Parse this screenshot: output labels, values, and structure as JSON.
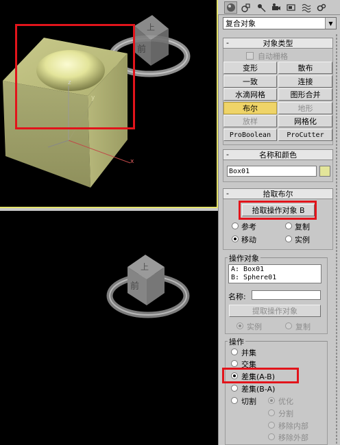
{
  "dropdown": {
    "value": "复合对象"
  },
  "object_type": {
    "header": "对象类型",
    "auto_grid": "自动栅格",
    "buttons": [
      "变形",
      "散布",
      "一致",
      "连接",
      "水滴网格",
      "图形合并",
      "布尔",
      "地形",
      "放样",
      "网格化",
      "ProBoolean",
      "ProCutter"
    ]
  },
  "name_color": {
    "header": "名称和颜色",
    "name": "Box01",
    "color": "#e3e59a"
  },
  "pick_boolean": {
    "header": "拾取布尔",
    "pick_button": "拾取操作对象 B",
    "options": [
      "参考",
      "复制",
      "移动",
      "实例"
    ]
  },
  "operands": {
    "title": "操作对象",
    "items": [
      "A: Box01",
      "B: Sphere01"
    ],
    "name_label": "名称:",
    "extract_button": "提取操作对象",
    "extract_options": [
      "实例",
      "复制"
    ]
  },
  "operation": {
    "title": "操作",
    "options": [
      "并集",
      "交集",
      "差集(A-B)",
      "差集(B-A)",
      "切割"
    ],
    "cut_options": [
      "优化",
      "分割",
      "移除内部",
      "移除外部"
    ]
  },
  "viewport": {
    "gizmo_labels": [
      "z",
      "y",
      "x"
    ],
    "viewcube_faces": [
      "上",
      "前"
    ]
  }
}
